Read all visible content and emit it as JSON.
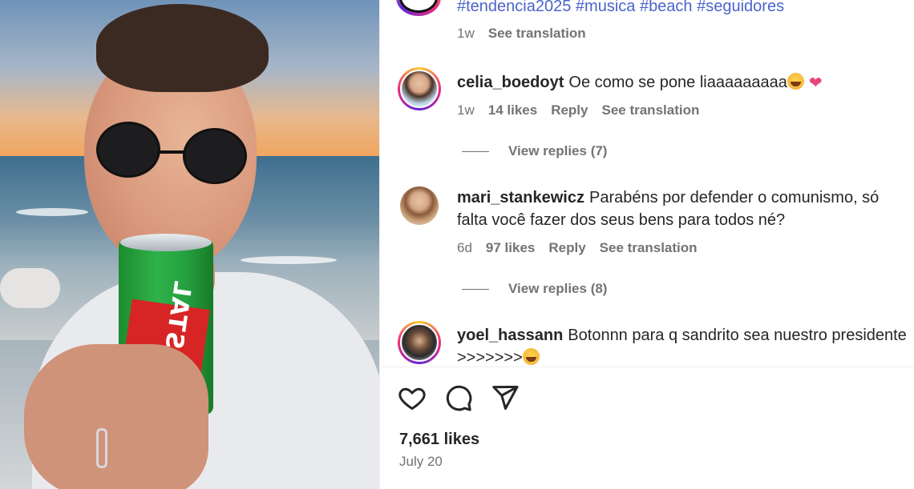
{
  "post": {
    "hashtags": "#tendencia2025 #musica #beach #seguidores",
    "caption_age": "1w",
    "caption_see_translation": "See translation",
    "media_can_text": "CRISTAL"
  },
  "comments": [
    {
      "username": "celia_boedoyt",
      "text": "Oe como se pone liaaaaaaaaa",
      "age": "1w",
      "likes": "14 likes",
      "reply": "Reply",
      "see_translation": "See translation",
      "view_replies": "View replies (7)"
    },
    {
      "username": "mari_stankewicz",
      "text": "Parabéns por defender o comunismo, só falta você fazer dos seus bens para todos né?",
      "age": "6d",
      "likes": "97 likes",
      "reply": "Reply",
      "see_translation": "See translation",
      "view_replies": "View replies (8)"
    },
    {
      "username": "yoel_hassann",
      "text": "Botonnn para q sandrito sea nuestro presidente >>>>>>>"
    }
  ],
  "footer": {
    "likes": "7,661 likes",
    "date": "July 20"
  },
  "colors": {
    "hashtag": "#4b64c9",
    "muted": "#737373",
    "text": "#262626",
    "heart_emoji": "#e8457a"
  },
  "icons": [
    "heart-icon",
    "comment-icon",
    "share-icon"
  ]
}
